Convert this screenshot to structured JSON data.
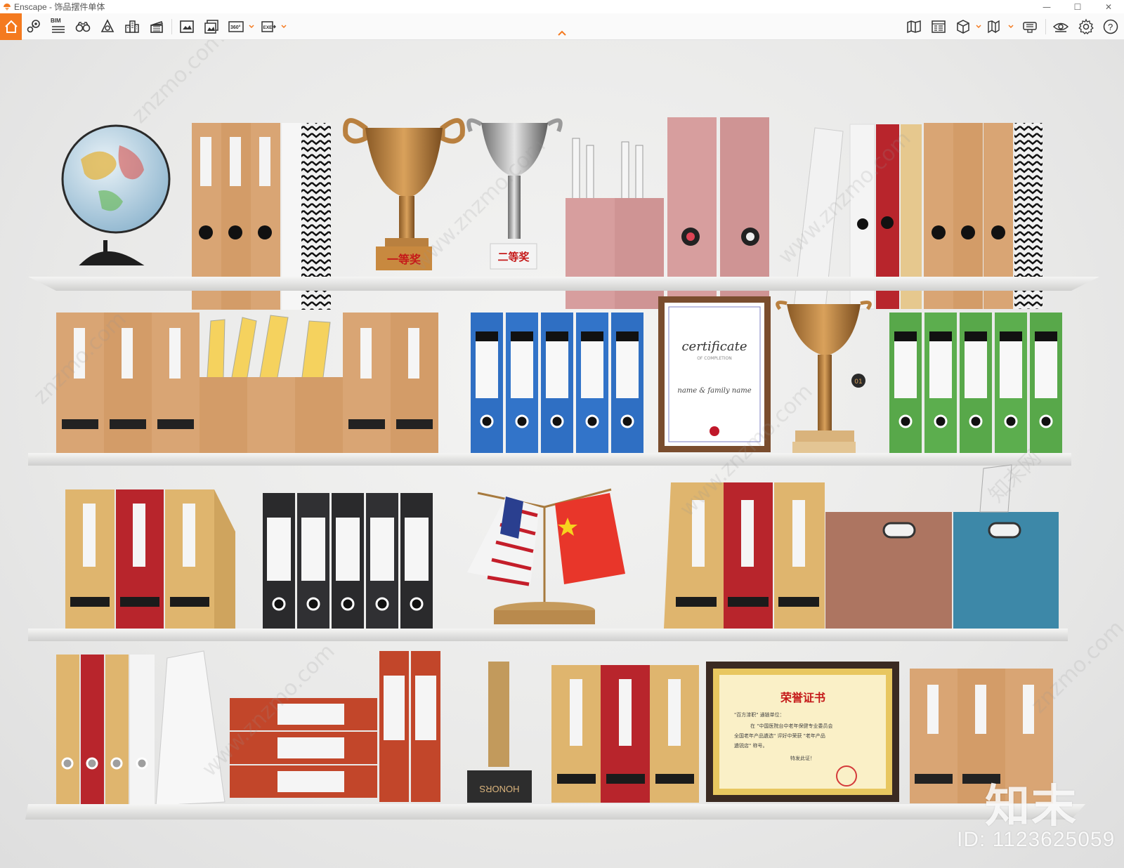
{
  "window": {
    "title": "Enscape - 饰品摆件单体",
    "controls": {
      "minimize": "—",
      "maximize": "☐",
      "close": "✕"
    }
  },
  "toolbar": {
    "home": "home-icon",
    "left_tools": [
      "map-pin-icon",
      "bim-icon",
      "binoculars-icon",
      "asset-library-icon",
      "buildings-icon",
      "clapper-icon"
    ],
    "bim_label": "BIM",
    "capture_tools": [
      "screenshot-icon",
      "batch-render-icon",
      "panorama-360-icon",
      "exe-export-icon"
    ],
    "panorama_label": "360°",
    "exe_label": "EXE",
    "right_tools": [
      "map-icon",
      "visual-settings-icon",
      "cube-view-icon",
      "book-icon",
      "vr-headset-icon",
      "eye-icon",
      "gear-icon",
      "help-icon"
    ],
    "help_label": "?"
  },
  "scene": {
    "trophy_label_1": "一等奖",
    "trophy_label_2": "二等奖",
    "certificate_title": "certificate",
    "certificate_sub": "OF COMPLETION",
    "certificate_name": "name & family name",
    "honor_title": "荣誉证书",
    "honor_line1": "\"百方漆职\" 通链单位：",
    "honor_line2": "在 \"中国医院台中老年保健专业委员会",
    "honor_line3": "全国老年产品遴选\" 评好中荣获 \"老年产品",
    "honor_line4": "遴锐店\" 称号。",
    "honor_line5": "特发此证！",
    "honors_block": "HONORS",
    "medal_number": "01",
    "watermarks": [
      "www.znzmo.com",
      "znzmo.com",
      "知末网"
    ]
  },
  "brand": {
    "logo_text": "知末",
    "id_text": "ID: 1123625059"
  },
  "colors": {
    "accent": "#f47a1f",
    "kraft": "#d9a574",
    "blue_binder": "#2f6fc3",
    "green_binder": "#58a84a",
    "red_binder": "#b8252c",
    "black_binder": "#2a2a2c",
    "pink_holder": "#d79e9e",
    "teal_box": "#3d88a8"
  }
}
